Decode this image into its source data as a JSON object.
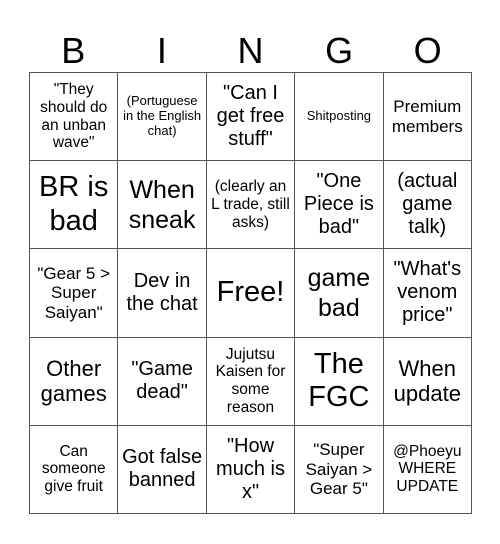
{
  "header": {
    "letters": [
      "B",
      "I",
      "N",
      "G",
      "O"
    ]
  },
  "cells": [
    [
      "\"They should do an unban wave\"",
      "(Portuguese in the English chat)",
      "\"Can I get free stuff\"",
      "Shitposting",
      "Premium members"
    ],
    [
      "BR is bad",
      "When sneak",
      "(clearly an L trade, still asks)",
      "\"One Piece is bad\"",
      "(actual game talk)"
    ],
    [
      "\"Gear 5 > Super Saiyan\"",
      "Dev in the chat",
      "Free!",
      "game bad",
      "\"What's venom price\""
    ],
    [
      "Other games",
      "\"Game dead\"",
      "Jujutsu Kaisen for some reason",
      "The FGC",
      "When update"
    ],
    [
      "Can someone give fruit",
      "Got false banned",
      "\"How much is x\"",
      "\"Super Saiyan > Gear 5\"",
      "@Phoeyu WHERE UPDATE"
    ]
  ]
}
